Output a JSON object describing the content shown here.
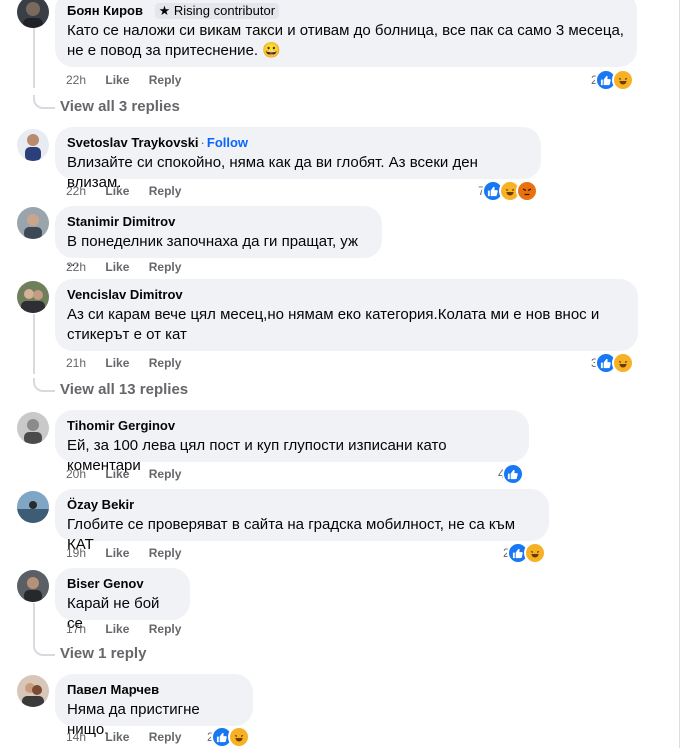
{
  "comments": [
    {
      "name": "Боян Киров",
      "badge": "Rising contributor",
      "lines": [
        "Като се наложи си викам такси и отивам до болница, все пак са само 3 месеца,",
        "не е повод за притеснение. 😀"
      ],
      "time": "22h",
      "like": "Like",
      "reply": "Reply",
      "react_count": "2",
      "replies": "View all 3 replies"
    },
    {
      "name": "Svetoslav Traykovski",
      "follow": "Follow",
      "lines": [
        "Влизайте си спокойно, няма как да ви глобят. Аз всеки ден влизам."
      ],
      "time": "22h",
      "like": "Like",
      "reply": "Reply",
      "react_count": "7"
    },
    {
      "name": "Stanimir Dimitrov",
      "lines": [
        "В понеделник започнаха да ги пращат, уж ..."
      ],
      "time": "22h",
      "like": "Like",
      "reply": "Reply"
    },
    {
      "name": "Vencislav Dimitrov",
      "lines": [
        "Аз си карам вече цял месец,но нямам еко категория.Колата ми е нов внос и",
        "стикерът е от кат"
      ],
      "time": "21h",
      "like": "Like",
      "reply": "Reply",
      "react_count": "3",
      "replies": "View all 13 replies"
    },
    {
      "name": "Tihomir Gerginov",
      "lines": [
        "Ей, за 100 лева цял пост и куп глупости изписани като коментари"
      ],
      "time": "20h",
      "like": "Like",
      "reply": "Reply",
      "react_count": "4"
    },
    {
      "name": "Özay Bekir",
      "lines": [
        "Глобите се проверяват в сайта на градска мобилност, не са към КАТ"
      ],
      "time": "19h",
      "like": "Like",
      "reply": "Reply",
      "react_count": "2"
    },
    {
      "name": "Biser Genov",
      "lines": [
        "Карай не бой се"
      ],
      "time": "17h",
      "like": "Like",
      "reply": "Reply",
      "replies": "View 1 reply"
    },
    {
      "name": "Павел Марчев",
      "lines": [
        "Няма да пристигне нищо."
      ],
      "time": "14h",
      "like": "Like",
      "reply": "Reply",
      "react_count": "2"
    }
  ],
  "icons": {
    "star": "star-icon",
    "like": "like-reaction-icon",
    "haha": "haha-reaction-icon",
    "angry": "angry-reaction-icon"
  },
  "colors": {
    "bubble": "#f0f2f5",
    "meta": "#65676b",
    "like": "#1877f2",
    "link": "#0866ff"
  }
}
